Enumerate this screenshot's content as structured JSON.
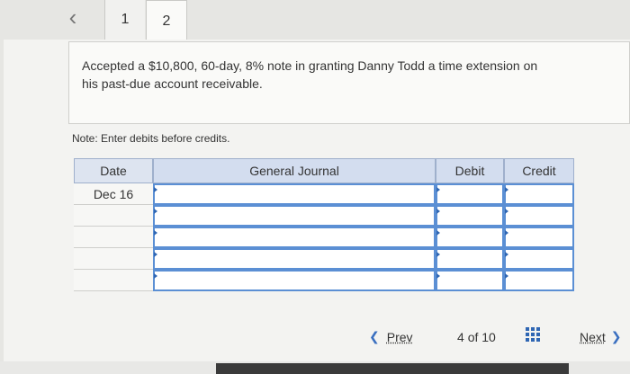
{
  "tabs": [
    {
      "label": "1"
    },
    {
      "label": "2"
    }
  ],
  "question": {
    "text": "Accepted a $10,800, 60-day, 8% note in granting Danny Todd a time extension on his past-due account receivable."
  },
  "note": "Note: Enter debits before credits.",
  "journal": {
    "headers": {
      "date": "Date",
      "account": "General Journal",
      "debit": "Debit",
      "credit": "Credit"
    },
    "rows": [
      {
        "date": "Dec 16"
      },
      {
        "date": ""
      },
      {
        "date": ""
      },
      {
        "date": ""
      },
      {
        "date": ""
      }
    ]
  },
  "footer": {
    "prev_label": "Prev",
    "page_current": "4",
    "page_of": "of",
    "page_total": "10",
    "next_label": "Next"
  },
  "icons": {
    "back": "chevron-left-icon",
    "prev": "chevron-left-icon",
    "next": "chevron-right-icon",
    "grid": "grid-icon"
  },
  "colors": {
    "header_blue": "#d3ddef",
    "input_border": "#5b8fd4",
    "link_blue": "#2f66b3"
  }
}
